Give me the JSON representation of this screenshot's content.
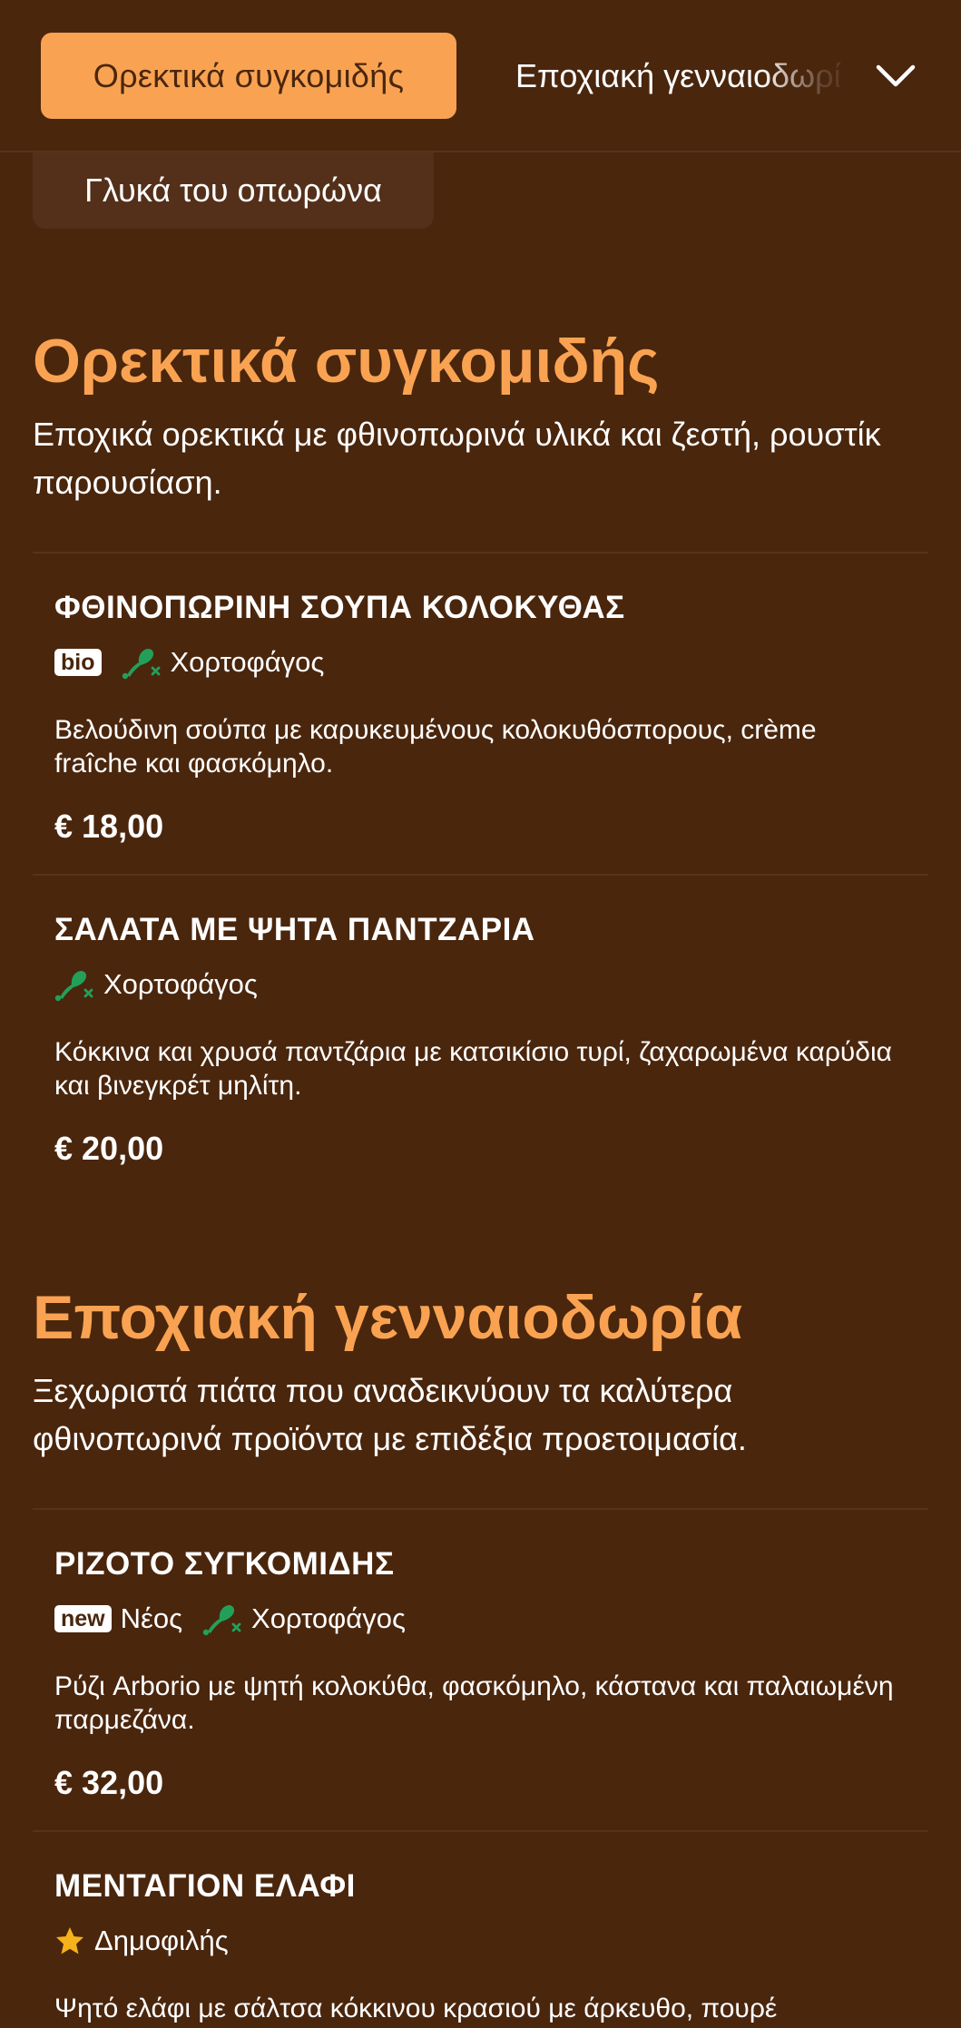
{
  "categories": {
    "active_label": "Ορεκτικά συγκομιδής",
    "next_label": "Εποχιακή γενναιοδωρία",
    "second_row_label": "Γλυκά του οπωρώνα",
    "toggle_icon": "chevron-down-icon"
  },
  "sections": [
    {
      "title": "Ορεκτικά συγκομιδής",
      "description": "Εποχικά ορεκτικά με φθινοπωρινά υλικά και ζεστή, ρουστίκ παρουσίαση.",
      "items": [
        {
          "name": "ΦΘΙΝΟΠΩΡΙΝΗ ΣΟΥΠΑ ΚΟΛΟΚΥΘΑΣ",
          "badge_bio": "bio",
          "tag_vegetarian": "Χορτοφάγος",
          "description": "Βελούδινη σούπα με καρυκευμένους κολοκυθόσπορους, crème fraîche και φασκόμηλο.",
          "price": "€ 18,00"
        },
        {
          "name": "ΣΑΛΑΤΑ ΜΕ ΨΗΤΑ ΠΑΝΤΖΑΡΙΑ",
          "tag_vegetarian": "Χορτοφάγος",
          "description": "Κόκκινα και χρυσά παντζάρια με κατσικίσιο τυρί, ζαχαρωμένα καρύδια και βινεγκρέτ μηλίτη.",
          "price": "€ 20,00"
        }
      ]
    },
    {
      "title": "Εποχιακή γενναιοδωρία",
      "description": "Ξεχωριστά πιάτα που αναδεικνύουν τα καλύτερα φθινοπωρινά προϊόντα με επιδέξια προετοιμασία.",
      "items": [
        {
          "name": "ΡΙΖΟΤΟ ΣΥΓΚΟΜΙΔΗΣ",
          "badge_new": "new",
          "tag_new": "Νέος",
          "tag_vegetarian": "Χορτοφάγος",
          "description": "Ρύζι Arborio με ψητή κολοκύθα, φασκόμηλο, κάστανα και παλαιωμένη παρμεζάνα.",
          "price": "€ 32,00"
        },
        {
          "name": "ΜΕΝΤΑΓΙΟΝ ΕΛΑΦΙ",
          "tag_popular": "Δημοφιλής",
          "description": "Ψητό ελάφι με σάλτσα κόκκινου κρασιού με άρκευθο, πουρέ"
        }
      ]
    }
  ],
  "colors": {
    "background": "#4a260d",
    "accent": "#f9a352",
    "divider": "#5a321a",
    "vegetarian_icon": "#22a05a",
    "star": "#f5b21b"
  }
}
